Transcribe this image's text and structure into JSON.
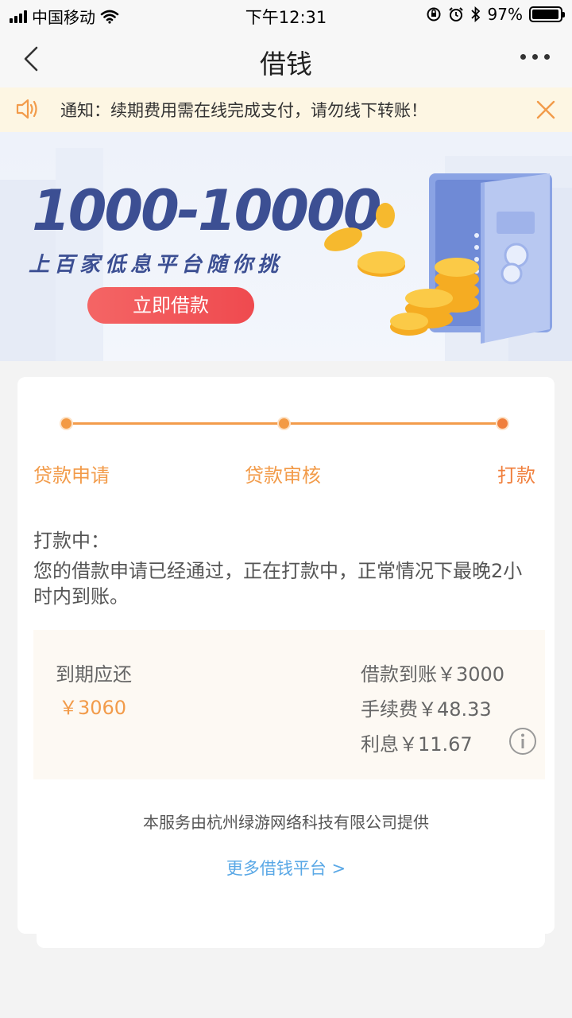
{
  "status_bar": {
    "carrier": "中国移动",
    "time": "下午12:31",
    "battery": "97%",
    "battery_level": 0.97
  },
  "nav": {
    "title": "借钱"
  },
  "notice": {
    "text": "通知：续期费用需在线完成支付，请勿线下转账！"
  },
  "banner": {
    "headline": "1000-10000",
    "subline": "上百家低息平台随你挑",
    "button": "立即借款"
  },
  "steps": [
    {
      "label": "贷款申请"
    },
    {
      "label": "贷款审核"
    },
    {
      "label": "打款"
    }
  ],
  "status": {
    "title": "打款中：",
    "description": "您的借款申请已经通过，正在打款中，正常情况下最晚2小时内到账。"
  },
  "repayment": {
    "due_label": "到期应还",
    "due_amount": "￥3060",
    "loan_received": "借款到账￥3000",
    "fee": "手续费￥48.33",
    "interest": "利息￥11.67"
  },
  "footer": {
    "provider": "本服务由杭州绿游网络科技有限公司提供",
    "more_link": "更多借钱平台 >"
  },
  "colors": {
    "accent": "#f29b4a",
    "link": "#5aa8e6",
    "banner_text": "#3c4f93",
    "banner_button": "#ef4a4f"
  }
}
